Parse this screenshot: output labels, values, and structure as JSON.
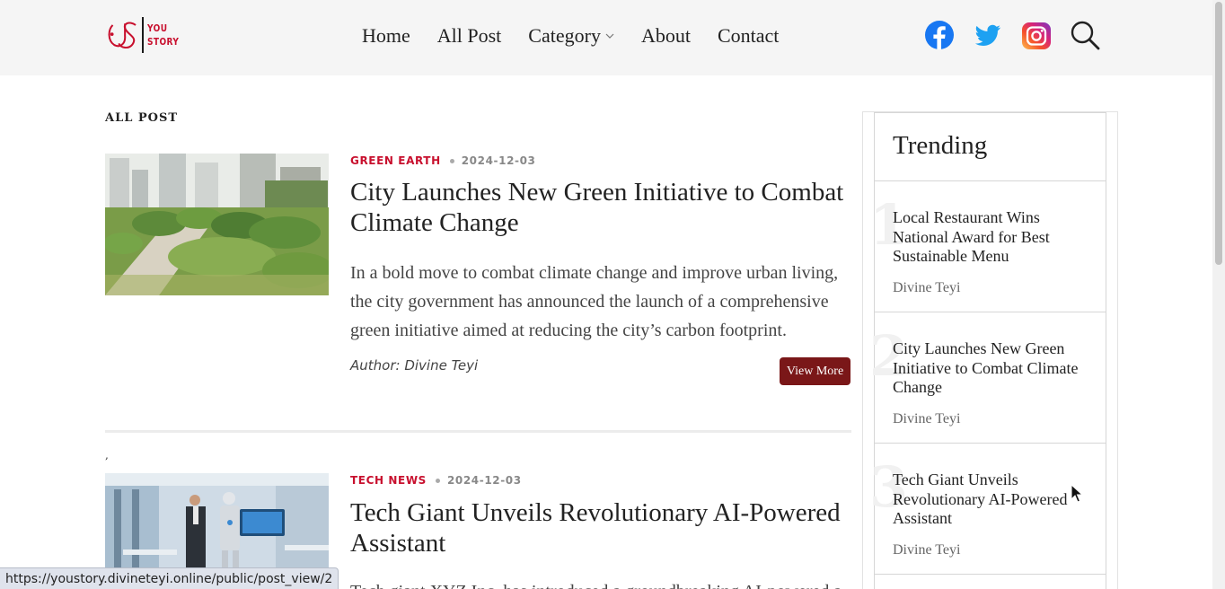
{
  "header": {
    "logo": {
      "text_line1": "YOU",
      "text_line2": "STORY",
      "brand_color": "#c8102e"
    },
    "nav": [
      {
        "label": "Home"
      },
      {
        "label": "All Post"
      },
      {
        "label": "Category",
        "has_dropdown": true
      },
      {
        "label": "About"
      },
      {
        "label": "Contact"
      }
    ],
    "socials": [
      {
        "icon": "facebook-icon",
        "color": "#1877f2"
      },
      {
        "icon": "twitter-icon",
        "color": "#1da1f2"
      },
      {
        "icon": "instagram-icon",
        "color": "#e1306c"
      },
      {
        "icon": "search-icon",
        "color": "#222222"
      }
    ]
  },
  "main": {
    "section_title": "ALL POST",
    "stray_mark": ",",
    "posts": [
      {
        "category": "GREEN EARTH",
        "date": "2024-12-03",
        "title": "City Launches New Green Initiative to Combat Climate Change",
        "excerpt": "In a bold move to combat climate change and improve urban living, the city government has announced the launch of a comprehensive green initiative aimed at reducing the city’s carbon footprint.",
        "author": "Author: Divine Teyi",
        "button": "View More"
      },
      {
        "category": "TECH NEWS",
        "date": "2024-12-03",
        "title": "Tech Giant Unveils Revolutionary AI-Powered Assistant",
        "excerpt": "Tech giant XYZ Inc. has introduced a groundbreaking AI-powered assistant"
      }
    ]
  },
  "sidebar": {
    "title": "Trending",
    "items": [
      {
        "rank": "1",
        "title": "Local Restaurant Wins National Award for Best Sustainable Menu",
        "author": "Divine Teyi"
      },
      {
        "rank": "2",
        "title": "City Launches New Green Initiative to Combat Climate Change",
        "author": "Divine Teyi"
      },
      {
        "rank": "3",
        "title": "Tech Giant Unveils Revolutionary AI-Powered Assistant",
        "author": "Divine Teyi"
      }
    ]
  },
  "status_bar": {
    "url": "https://youstory.divineteyi.online/public/post_view/2"
  },
  "colors": {
    "accent": "#c8102e",
    "button": "#7a1718",
    "header_bg": "#f5f5f5"
  }
}
